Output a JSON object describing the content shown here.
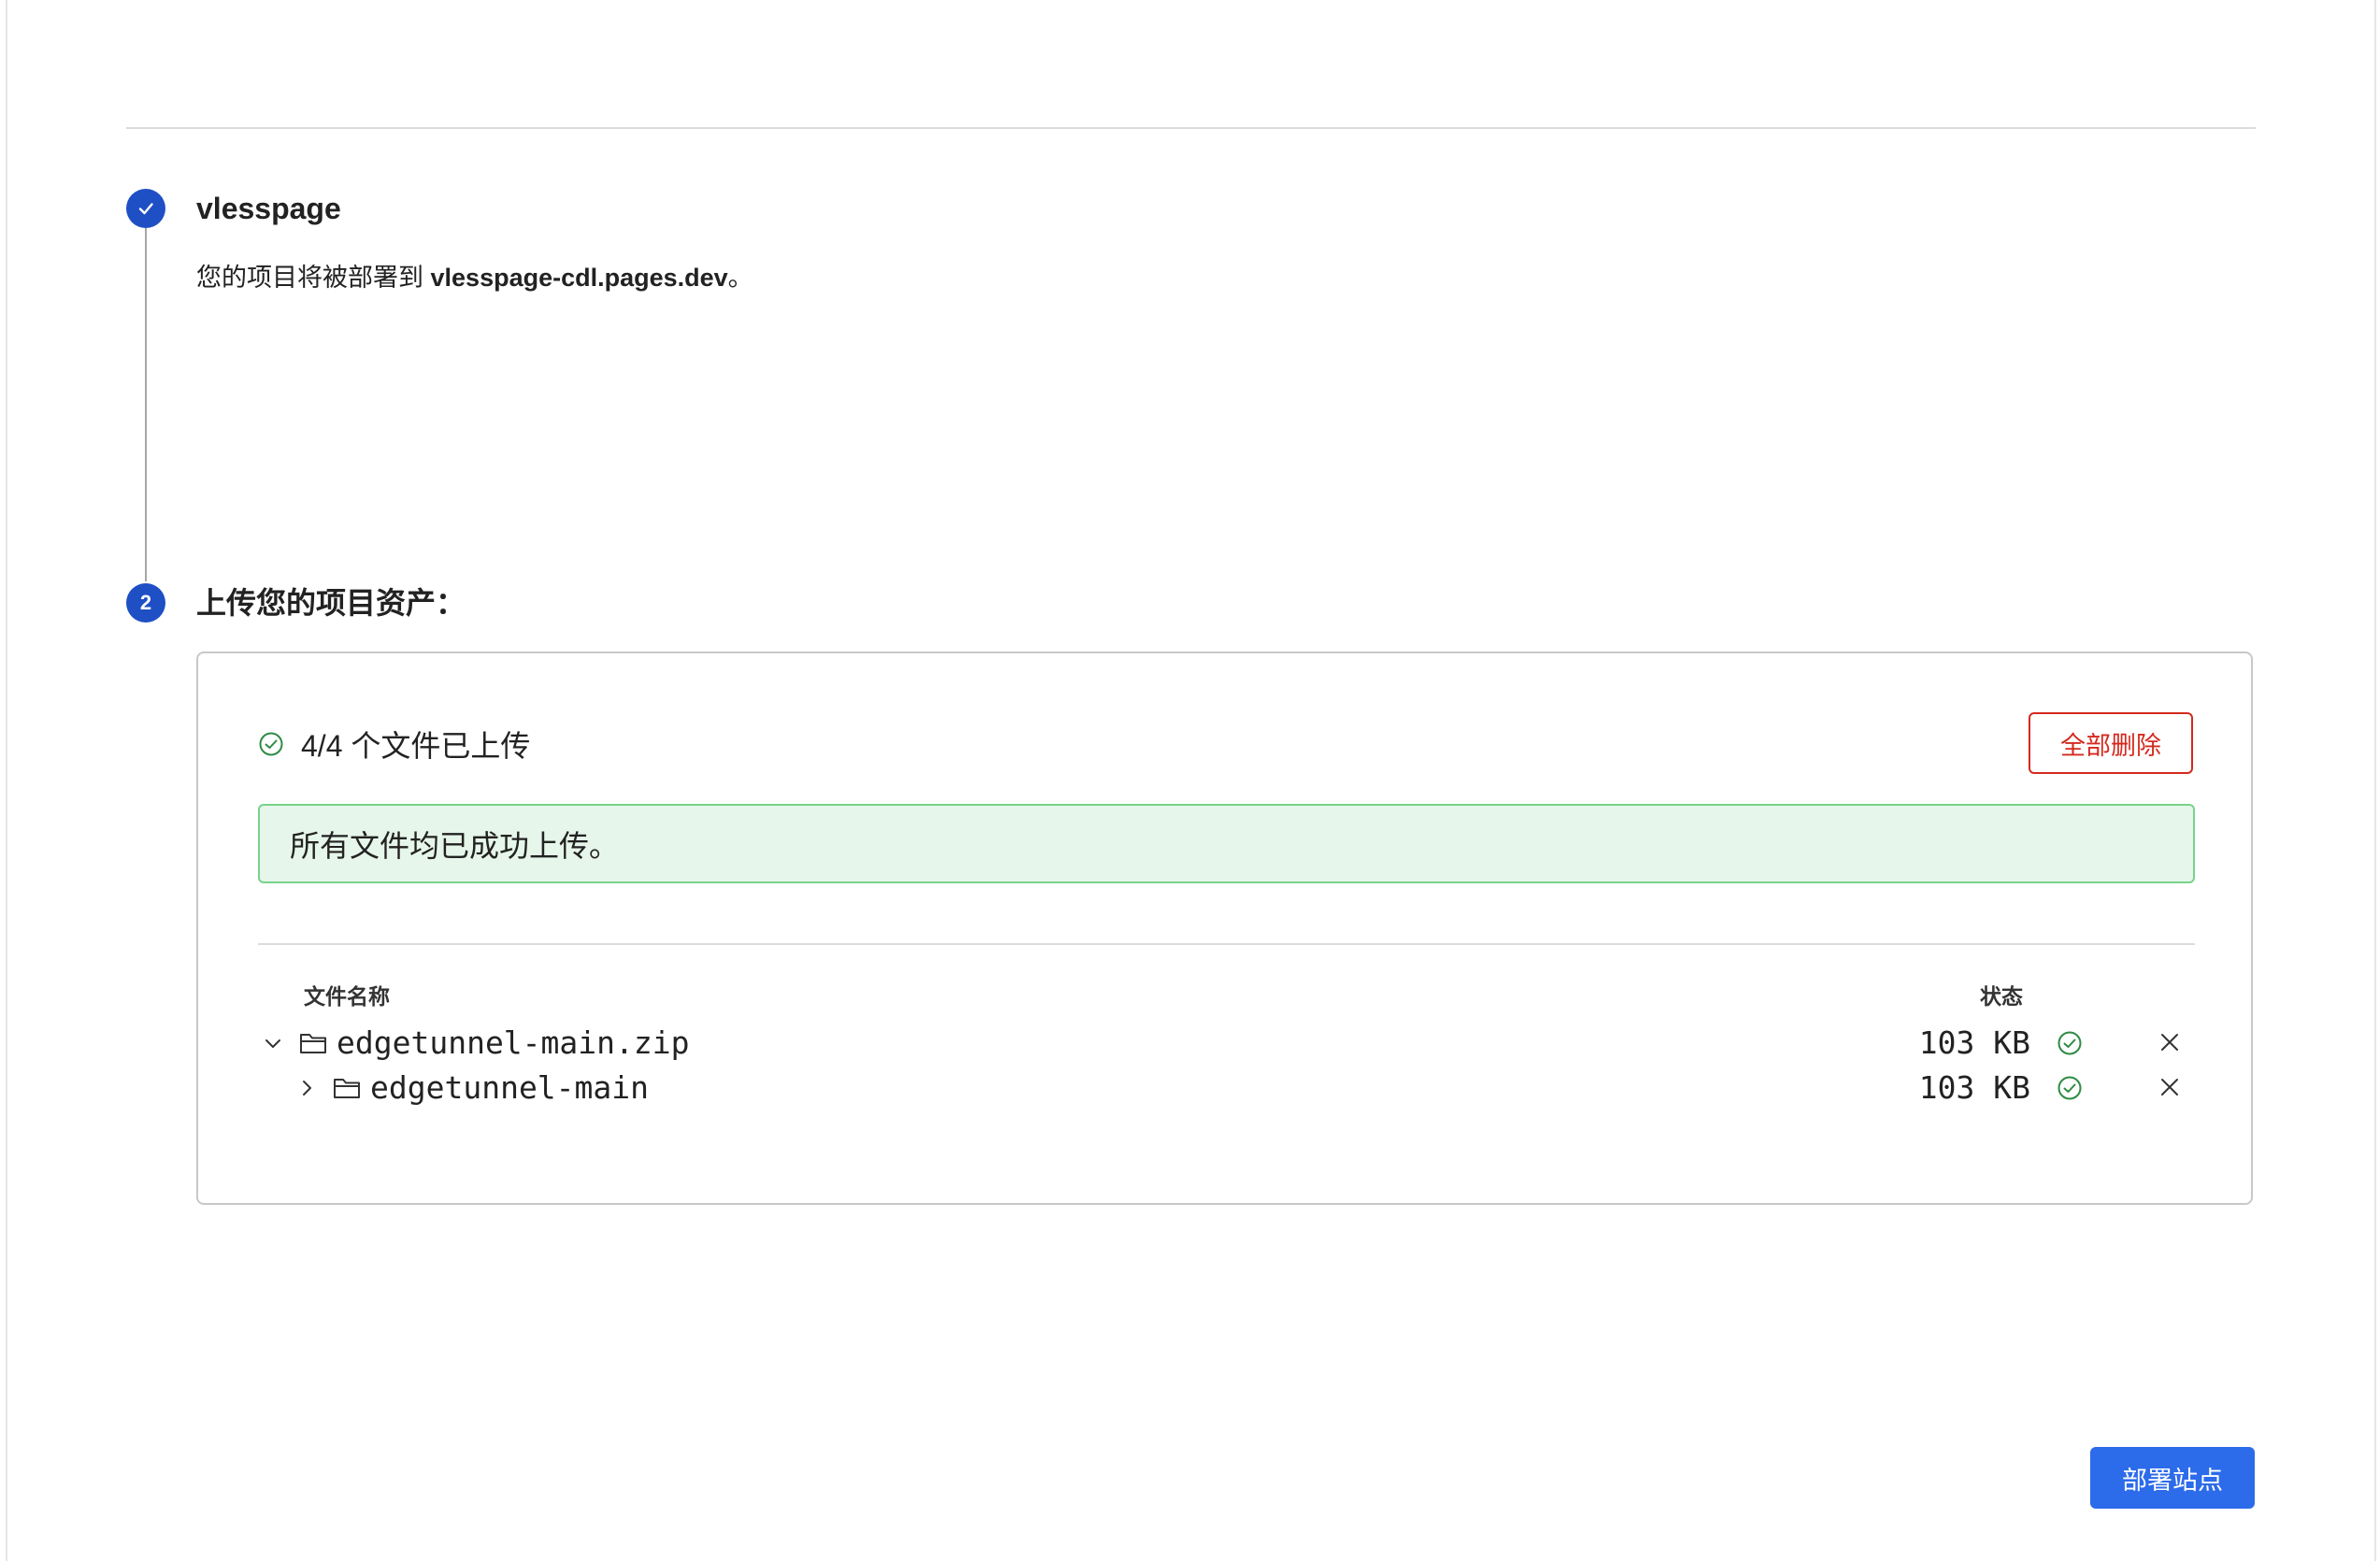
{
  "step1": {
    "number_icon": "check-icon",
    "title": "vlesspage",
    "desc_prefix": "您的项目将被部署到 ",
    "desc_domain": "vlesspage-cdl.pages.dev",
    "desc_suffix": "。"
  },
  "step2": {
    "number": "2",
    "title": "上传您的项目资产："
  },
  "upload": {
    "status_icon": "check-circle-icon",
    "status_text": "4/4 个文件已上传",
    "delete_all_label": "全部删除",
    "delete_all_color": "#d42a1f",
    "banner_text": "所有文件均已成功上传。",
    "banner_color": "#e6f6ea"
  },
  "table": {
    "col_name": "文件名称",
    "col_status": "状态",
    "rows": [
      {
        "name": "edgetunnel-main.zip",
        "size": "103 KB",
        "expanded": true,
        "status_icon": "check-circle-icon"
      },
      {
        "name": "edgetunnel-main",
        "size": "103 KB",
        "expanded": false,
        "status_icon": "check-circle-icon"
      }
    ]
  },
  "deploy_label": "部署站点",
  "colors": {
    "accent": "#2c6bea",
    "step_circle": "#1f4fc4",
    "success": "#2e8b44",
    "danger": "#d42a1f"
  }
}
